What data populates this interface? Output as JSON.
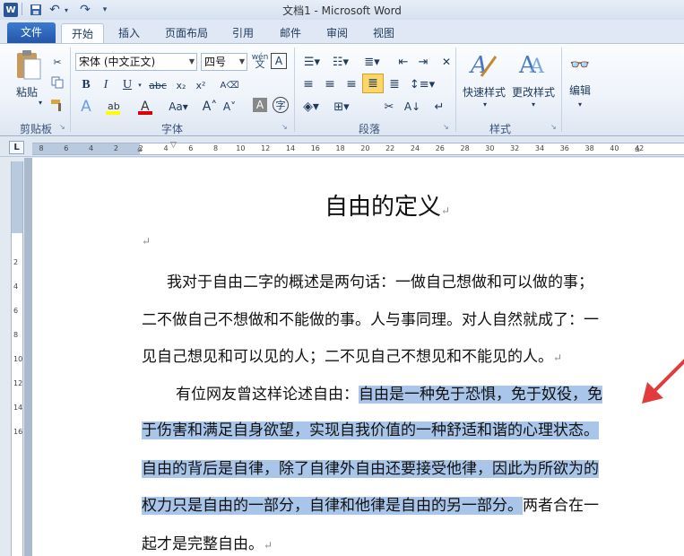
{
  "window": {
    "title": "文档1 - Microsoft Word"
  },
  "quick_access": {
    "app_icon": "W",
    "undo": "↶",
    "redo": "↷"
  },
  "tabs": [
    {
      "label": "文件"
    },
    {
      "label": "开始"
    },
    {
      "label": "插入"
    },
    {
      "label": "页面布局"
    },
    {
      "label": "引用"
    },
    {
      "label": "邮件"
    },
    {
      "label": "审阅"
    },
    {
      "label": "视图"
    }
  ],
  "ribbon": {
    "clipboard": {
      "paste_label": "粘贴",
      "group_label": "剪贴板"
    },
    "font": {
      "font_name": "宋体 (中文正文)",
      "font_size": "四号",
      "group_label": "字体",
      "wen": "wén",
      "a_box": "A"
    },
    "paragraph": {
      "group_label": "段落"
    },
    "styles": {
      "quick_styles": "快速样式",
      "change_styles": "更改样式",
      "group_label": "样式"
    },
    "editing": {
      "label": "编辑"
    }
  },
  "ruler": {
    "corner": "L",
    "marks": [
      "8",
      "6",
      "4",
      "2",
      "2",
      "4",
      "6",
      "8",
      "10",
      "12",
      "14",
      "16",
      "18",
      "20",
      "22",
      "24",
      "26",
      "28",
      "30",
      "32",
      "34",
      "36",
      "38",
      "40",
      "42"
    ],
    "vmarks": [
      "2",
      "4",
      "6",
      "8",
      "10",
      "12",
      "14",
      "16"
    ]
  },
  "document": {
    "title": "自由的定义",
    "p1": [
      "我对于自由二字的概述是两句话：一做自己想做和可以做的事；",
      "二不做自己不想做和不能做的事。人与事同理。对人自然就成了：一",
      "见自己想见和可以见的人；二不见自己不想见和不能见的人。"
    ],
    "p2_line1_plain": "有位网友曾这样论述自由：",
    "p2_line1_sel": "自由是一种免于恐惧，免于奴役，免",
    "p2_line2_sel": "于伤害和满足自身欲望，实现自我价值的一种舒适和谐的心理状态。",
    "p2_line3_sel": "自由的背后是自律，除了自律外自由还要接受他律，因此为所欲为的",
    "p2_line4_sel": "权力只是自由的一部分，自律和他律是自由的另一部分。",
    "p2_line4_plain": "两者合在一",
    "p2_line5": "起才是完整自由。",
    "pilcrow": "↵"
  },
  "colors": {
    "selection": "#a9c6ea",
    "file_tab": "#2a5ba8",
    "arrow": "#e23b3b"
  }
}
